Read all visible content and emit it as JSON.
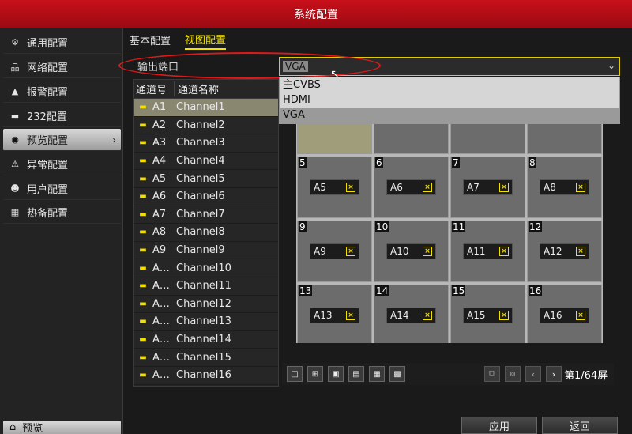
{
  "window": {
    "title": "系统配置"
  },
  "sidebar": {
    "items": [
      {
        "label": "通用配置",
        "icon": "gear-icon",
        "glyph": "⚙"
      },
      {
        "label": "网络配置",
        "icon": "network-icon",
        "glyph": "品"
      },
      {
        "label": "报警配置",
        "icon": "alarm-icon",
        "glyph": "▲"
      },
      {
        "label": "232配置",
        "icon": "serial-port-icon",
        "glyph": "▬"
      },
      {
        "label": "预览配置",
        "icon": "eye-icon",
        "glyph": "◉"
      },
      {
        "label": "异常配置",
        "icon": "warning-icon",
        "glyph": "⚠"
      },
      {
        "label": "用户配置",
        "icon": "users-icon",
        "glyph": "☻"
      },
      {
        "label": "热备配置",
        "icon": "hot-spare-icon",
        "glyph": "▦"
      }
    ],
    "active_index": 4,
    "bottom": {
      "label": "预览",
      "glyph": "⌂"
    }
  },
  "tabs": [
    {
      "label": "基本配置",
      "active": false
    },
    {
      "label": "视图配置",
      "active": true
    }
  ],
  "output_port": {
    "label": "输出端口",
    "value": "VGA",
    "options": [
      "主CVBS",
      "HDMI",
      "VGA"
    ],
    "selected_index": 2
  },
  "channel_table": {
    "headers": [
      "通道号",
      "通道名称"
    ],
    "rows": [
      {
        "num": "A1",
        "name": "Channel1"
      },
      {
        "num": "A2",
        "name": "Channel2"
      },
      {
        "num": "A3",
        "name": "Channel3"
      },
      {
        "num": "A4",
        "name": "Channel4"
      },
      {
        "num": "A5",
        "name": "Channel5"
      },
      {
        "num": "A6",
        "name": "Channel6"
      },
      {
        "num": "A7",
        "name": "Channel7"
      },
      {
        "num": "A8",
        "name": "Channel8"
      },
      {
        "num": "A9",
        "name": "Channel9"
      },
      {
        "num": "A…",
        "name": "Channel10"
      },
      {
        "num": "A…",
        "name": "Channel11"
      },
      {
        "num": "A…",
        "name": "Channel12"
      },
      {
        "num": "A…",
        "name": "Channel13"
      },
      {
        "num": "A…",
        "name": "Channel14"
      },
      {
        "num": "A…",
        "name": "Channel15"
      },
      {
        "num": "A…",
        "name": "Channel16"
      }
    ],
    "selected_index": 0
  },
  "view_grid": {
    "cells": [
      {
        "num": "",
        "tag": ""
      },
      {
        "num": "",
        "tag": ""
      },
      {
        "num": "",
        "tag": ""
      },
      {
        "num": "",
        "tag": ""
      },
      {
        "num": "5",
        "tag": "A5"
      },
      {
        "num": "6",
        "tag": "A6"
      },
      {
        "num": "7",
        "tag": "A7"
      },
      {
        "num": "8",
        "tag": "A8"
      },
      {
        "num": "9",
        "tag": "A9"
      },
      {
        "num": "10",
        "tag": "A10"
      },
      {
        "num": "11",
        "tag": "A11"
      },
      {
        "num": "12",
        "tag": "A12"
      },
      {
        "num": "13",
        "tag": "A13"
      },
      {
        "num": "14",
        "tag": "A14"
      },
      {
        "num": "15",
        "tag": "A15"
      },
      {
        "num": "16",
        "tag": "A16"
      }
    ]
  },
  "pager": {
    "text": "第1/64屏"
  },
  "buttons": {
    "apply": "应用",
    "back": "返回"
  },
  "colors": {
    "title_bar": "#c8101a",
    "accent": "#f2e000",
    "highlight_ellipse": "#e01818"
  }
}
